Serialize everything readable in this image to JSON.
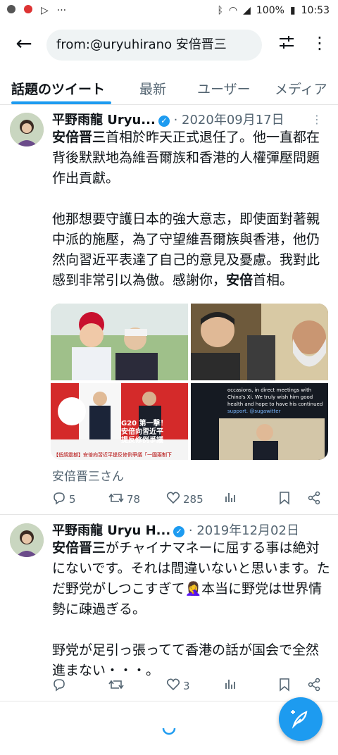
{
  "status": {
    "time": "10:53",
    "battery": "100%"
  },
  "search": {
    "query": "from:@uryuhirano 安倍晋三"
  },
  "tabs": [
    "話題のツイート",
    "最新",
    "ユーザー",
    "メディア"
  ],
  "tweets": [
    {
      "name": "平野雨龍 Uryu...",
      "date": "· 2020年09月17日",
      "line1_bold": "安倍晋三",
      "line1_rest": "首相於昨天正式退任了。他一直都在背後默默地為維吾爾族和香港的人權彈壓問題作出貢獻。",
      "para2_pre": "他那想要守護日本的強大意志，即使面對著親中派的施壓，為了守望維吾爾族與香港，他仍然向習近平表達了自己的意見及憂慮。我對此感到非常引以為傲。感謝你，",
      "para2_bold": "安倍",
      "para2_post": "首相。",
      "media_captions": {
        "img3_line1": "G20 第一擊！",
        "img3_line2": "安倍向習近平",
        "img3_line3": "提反修例爭議",
        "img3_footer": "【低調震撼】安倍向習近平提反修例爭議「一國兩制下",
        "img4_text1": "occasions, in direct meetings with",
        "img4_text2": "China's Xi. We truly wish him good",
        "img4_text3": "health and hope to have his continued",
        "img4_text4": "support. @sugawitter"
      },
      "caption": "安倍晋三さん",
      "replies": "5",
      "retweets": "78",
      "likes": "285"
    },
    {
      "name": "平野雨龍 Uryu H...",
      "date": "· 2019年12月02日",
      "line1_bold": "安倍晋三",
      "line1_rest": "がチャイナマネーに屈する事は絶対にないです。それは間違いないと思います。ただ野党がしつこすぎて",
      "line1_emoji": "🤦‍♀️",
      "line1_end": "本当に野党は世界情勢に疎過ぎる。",
      "para2": "野党が足引っ張ってて香港の話が国会で全然進まない・・・。",
      "replies": "",
      "retweets": "",
      "likes": "3"
    }
  ],
  "colors": {
    "accent": "#1d9bf0",
    "text": "#0f1419",
    "muted": "#536471"
  }
}
